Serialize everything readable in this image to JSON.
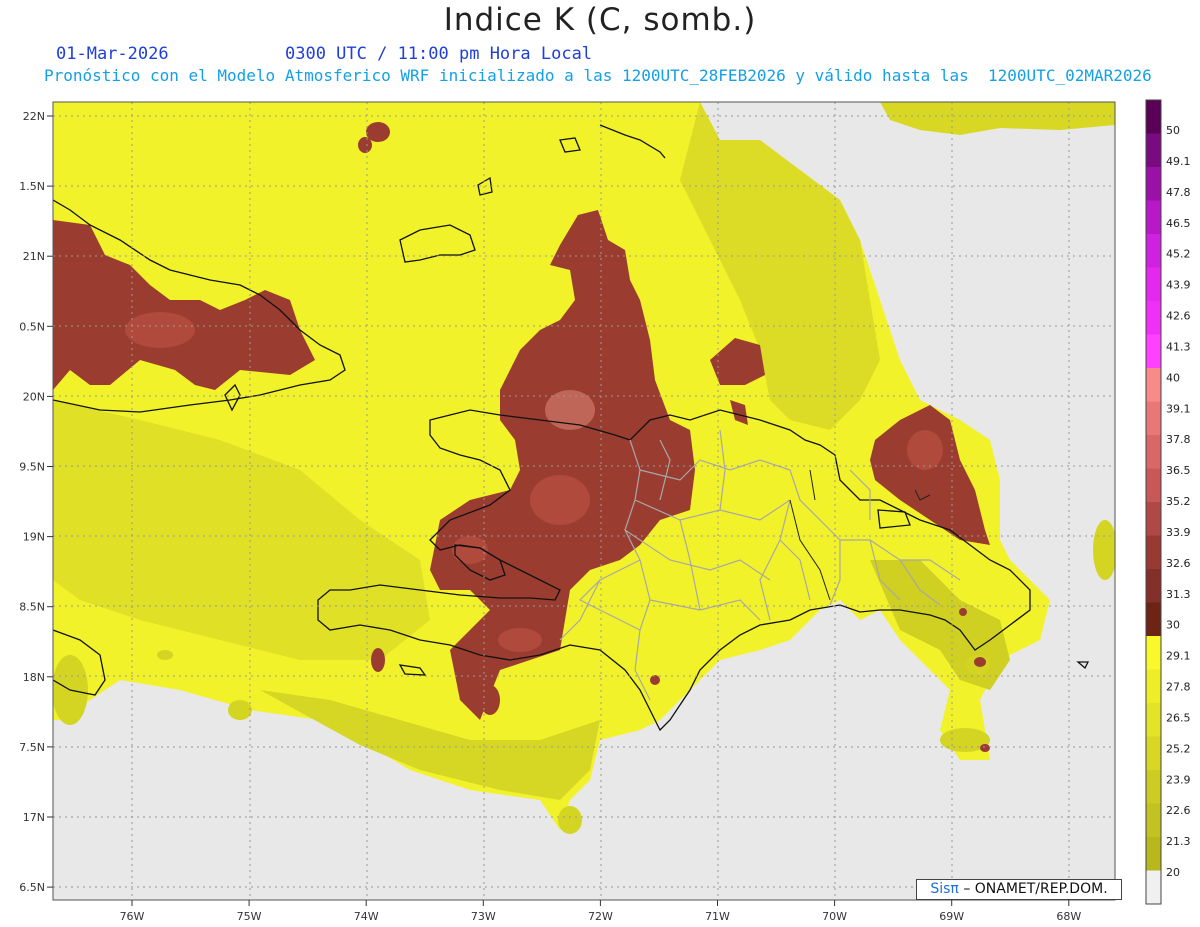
{
  "header": {
    "title": "Indice K (C, somb.)",
    "date": "01-Mar-2026",
    "time": "0300 UTC / 11:00 pm Hora Local",
    "description": "Pronóstico con el Modelo Atmosferico WRF inicializado a las 1200UTC_28FEB2026 y válido hasta las  1200UTC_02MAR2026"
  },
  "axes": {
    "lat_labels": [
      "22N",
      "1.5N",
      "21N",
      "0.5N",
      "20N",
      "9.5N",
      "19N",
      "8.5N",
      "18N",
      "7.5N",
      "17N",
      "6.5N"
    ],
    "lon_labels": [
      "76W",
      "75W",
      "74W",
      "73W",
      "72W",
      "71W",
      "70W",
      "69W",
      "68W"
    ],
    "lat_range": [
      16.5,
      22.1
    ],
    "lon_range": [
      -76.65,
      -67.4
    ]
  },
  "colorbar": {
    "labels": [
      "50",
      "49.1",
      "47.8",
      "46.5",
      "45.2",
      "43.9",
      "42.6",
      "41.3",
      "40",
      "39.1",
      "37.8",
      "36.5",
      "35.2",
      "33.9",
      "32.6",
      "31.3",
      "30",
      "29.1",
      "27.8",
      "26.5",
      "25.2",
      "23.9",
      "22.6",
      "21.3",
      "20"
    ],
    "colors": [
      "#5a0058",
      "#7a0a80",
      "#9a10a8",
      "#b818c8",
      "#d020e0",
      "#e428ee",
      "#f030f6",
      "#ff40ff",
      "#f88a8a",
      "#e87878",
      "#d86868",
      "#c85858",
      "#b04848",
      "#983a32",
      "#84302a",
      "#6e2414",
      "#f8f82a",
      "#eeee28",
      "#e4e426",
      "#d8d824",
      "#cccc22",
      "#c2c220",
      "#b8b81e",
      "#f0f0f0"
    ]
  },
  "colors": {
    "no_data": "#e8e8e8",
    "yellow_bright": "#f4f42a",
    "yellow_mid": "#e6e628",
    "yellow_dark": "#c8c821",
    "brown": "#9a3d30",
    "brown_dark": "#7a2a1c",
    "brown_light": "#c06658",
    "coast": "#111111",
    "borders": "#a8a8a8",
    "grid": "#999999"
  },
  "credit": {
    "brand": "Sisπ",
    "text": "– ONAMET/REP.DOM."
  }
}
